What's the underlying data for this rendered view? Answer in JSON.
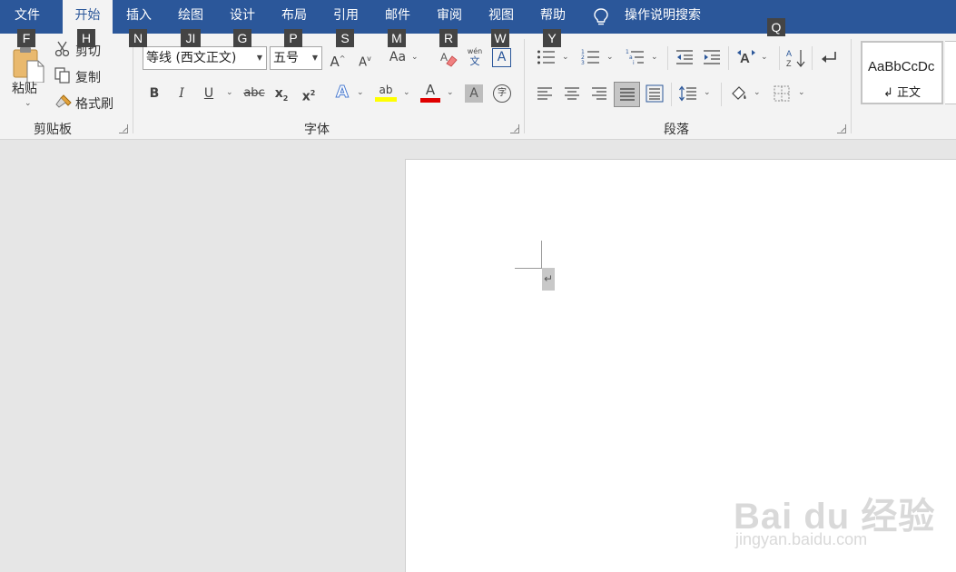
{
  "tabs": [
    {
      "label": "文件"
    },
    {
      "label": "开始"
    },
    {
      "label": "插入"
    },
    {
      "label": "绘图"
    },
    {
      "label": "设计"
    },
    {
      "label": "布局"
    },
    {
      "label": "引用"
    },
    {
      "label": "邮件"
    },
    {
      "label": "审阅"
    },
    {
      "label": "视图"
    },
    {
      "label": "帮助"
    }
  ],
  "tell_me": {
    "label": "操作说明搜索"
  },
  "keytips": [
    "F",
    "H",
    "N",
    "JI",
    "G",
    "P",
    "S",
    "M",
    "R",
    "W",
    "Y",
    "Q"
  ],
  "clipboard": {
    "paste_label": "粘贴",
    "cut_label": "剪切",
    "copy_label": "复制",
    "format_painter_label": "格式刷",
    "group_label": "剪贴板"
  },
  "font": {
    "font_name": "等线 (西文正文)",
    "font_size": "五号",
    "group_label": "字体",
    "bold": "B",
    "italic": "I",
    "underline": "U",
    "strike": "abc",
    "change_case": "Aa",
    "pinyin_top": "wén",
    "pinyin_char": "文",
    "border_char": "A",
    "font_color_char": "A",
    "shading_char": "A",
    "enclose_char": "字",
    "highlight_char": "ab",
    "effects_char": "A",
    "highlight_color": "#ffff00",
    "font_color": "#e00000"
  },
  "paragraph": {
    "group_label": "段落"
  },
  "styles": {
    "sample_text": "AaBbCcDc",
    "normal_name": "↲ 正文"
  },
  "document": {
    "paragraph_mark": "↵"
  },
  "watermark": {
    "brand": "Bai du 经验",
    "url": "jingyan.baidu.com"
  },
  "colors": {
    "accent": "#2b579a",
    "ribbon_bg": "#f3f3f3",
    "canvas_bg": "#e6e6e6"
  }
}
